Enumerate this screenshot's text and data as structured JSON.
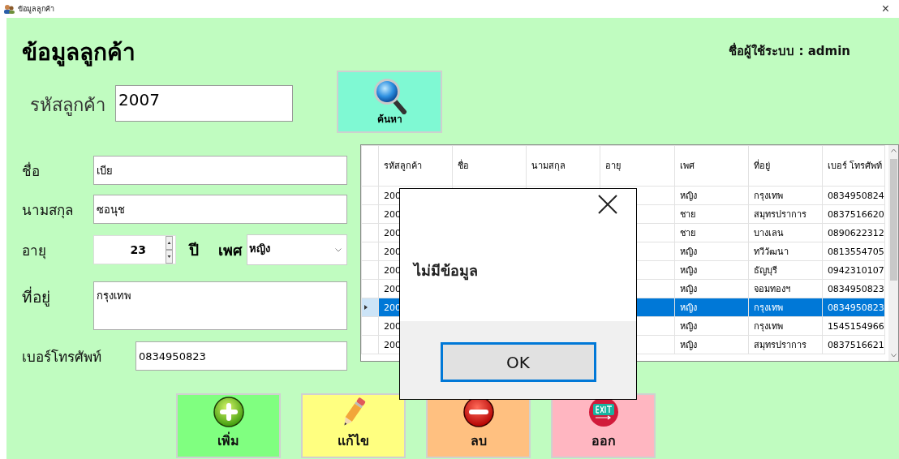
{
  "window": {
    "title": "ข้อมูลลูกค้า",
    "close": "×"
  },
  "heading": "ข้อมูลลูกค้า",
  "user_label": "ชื่อผู้ใช้ระบบ : admin",
  "customer_id": {
    "label": "รหัสลูกค้า",
    "value": "2007"
  },
  "search_button": "ค้นหา",
  "form": {
    "first_name": {
      "label": "ชื่อ",
      "value": "เบีย"
    },
    "last_name": {
      "label": "นามสกุล",
      "value": "ซอนุช"
    },
    "age": {
      "label": "อายุ",
      "value": "23",
      "unit": "ปี"
    },
    "gender": {
      "label": "เพศ",
      "value": "หญิง"
    },
    "address": {
      "label": "ที่อยู่",
      "value": "กรุงเทพ"
    },
    "phone": {
      "label": "เบอร์โทรศัพท์",
      "value": "0834950823"
    }
  },
  "table": {
    "columns": [
      "รหัสลูกค้า",
      "ชื่อ",
      "นามสกุล",
      "อายุ",
      "เพศ",
      "ที่อยู่",
      "เบอร์ โทรศัพท์"
    ],
    "rows": [
      {
        "id": "200",
        "gender": "หญิง",
        "address": "กรุงเทพ",
        "phone": "0834950824",
        "selected": false
      },
      {
        "id": "200",
        "gender": "ชาย",
        "address": "สมุทรปราการ",
        "phone": "0837516620",
        "selected": false
      },
      {
        "id": "200",
        "gender": "ชาย",
        "address": "บางเลน",
        "phone": "0890622312",
        "selected": false
      },
      {
        "id": "200",
        "gender": "หญิง",
        "address": "ทวีวัฒนา",
        "phone": "0813554705",
        "selected": false
      },
      {
        "id": "200",
        "gender": "หญิง",
        "address": "ธัญบุรี",
        "phone": "0942310107",
        "selected": false
      },
      {
        "id": "200",
        "gender": "หญิง",
        "address": "จอมทองฯ",
        "phone": "0834950823",
        "selected": false
      },
      {
        "id": "200",
        "gender": "หญิง",
        "address": "กรุงเทพ",
        "phone": "0834950823",
        "selected": true
      },
      {
        "id": "200",
        "gender": "หญิง",
        "address": "กรุงเทพ",
        "phone": "1545154966",
        "selected": false
      },
      {
        "id": "200",
        "gender": "หญิง",
        "address": "สมุทรปราการ",
        "phone": "0837516621",
        "selected": false
      }
    ]
  },
  "dialog": {
    "message": "ไม่มีข้อมูล",
    "button": "OK"
  },
  "buttons": [
    {
      "label": "เพิ่ม",
      "kind": "add"
    },
    {
      "label": "แก้ไข",
      "kind": "edit"
    },
    {
      "label": "ลบ",
      "kind": "delete"
    },
    {
      "label": "ออก",
      "kind": "exit"
    }
  ]
}
